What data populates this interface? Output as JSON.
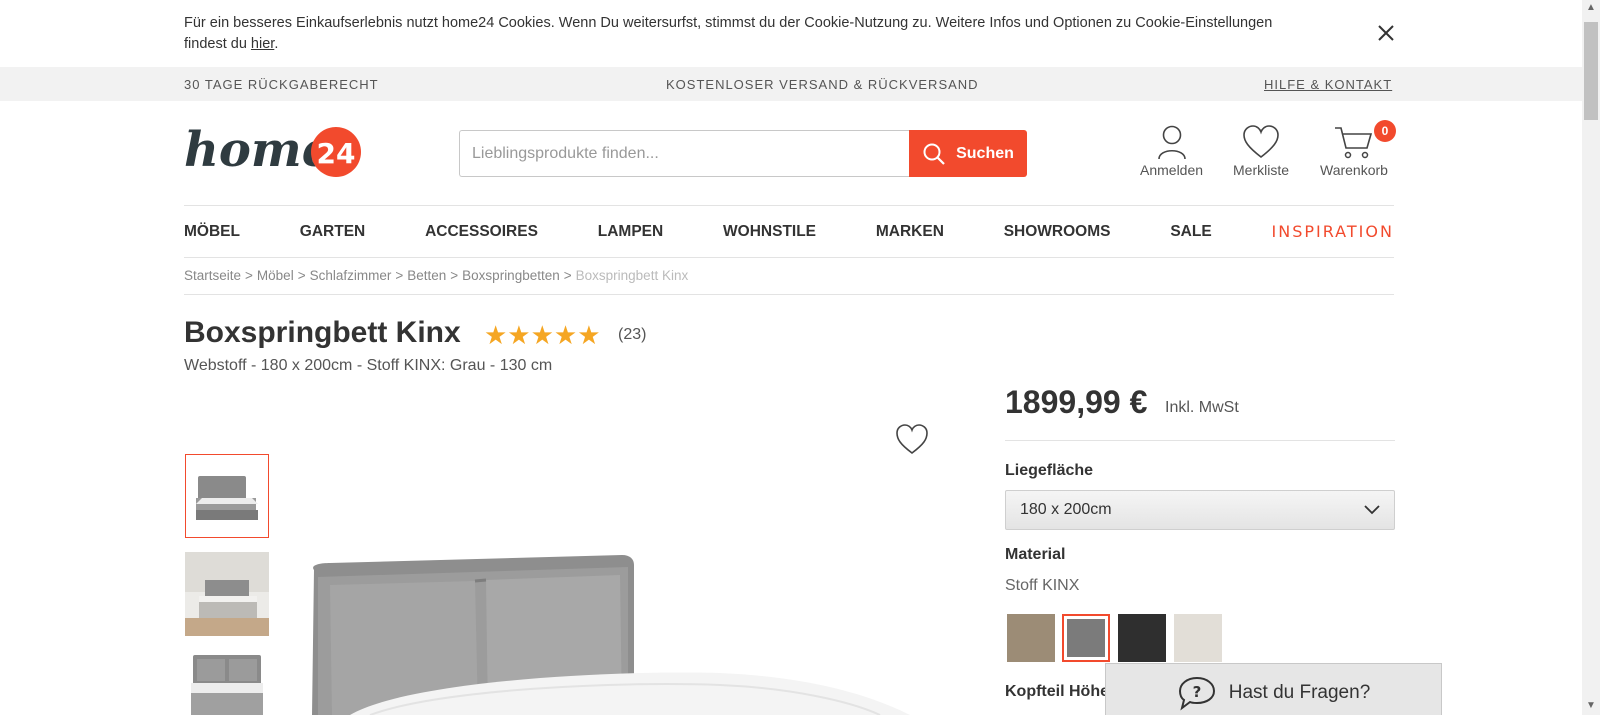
{
  "cookie": {
    "text": "Für ein besseres Einkaufserlebnis nutzt home24 Cookies. Wenn Du weitersurfst, stimmst du der Cookie-Nutzung zu. Weitere Infos und Optionen zu Cookie-Einstellungen findest du ",
    "link": "hier",
    "suffix": "."
  },
  "service": {
    "left": "30 TAGE RÜCKGABERECHT",
    "center": "KOSTENLOSER VERSAND & RÜCKVERSAND",
    "right": "HILFE & KONTAKT"
  },
  "header": {
    "logo_text": "home",
    "logo_number": "24",
    "search_placeholder": "Lieblingsprodukte finden...",
    "search_button": "Suchen",
    "login": "Anmelden",
    "wishlist": "Merkliste",
    "cart": "Warenkorb",
    "cart_count": "0"
  },
  "nav": [
    "MÖBEL",
    "GARTEN",
    "ACCESSOIRES",
    "LAMPEN",
    "WOHNSTILE",
    "MARKEN",
    "SHOWROOMS",
    "SALE",
    "INSPIRATION"
  ],
  "breadcrumb": [
    "Startseite",
    "Möbel",
    "Schlafzimmer",
    "Betten",
    "Boxspringbetten"
  ],
  "breadcrumb_current": "Boxspringbett Kinx",
  "breadcrumb_sep": ">",
  "product": {
    "title": "Boxspringbett Kinx",
    "stars": "★★★★★",
    "reviews": "(23)",
    "subtitle": "Webstoff - 180 x 200cm - Stoff KINX: Grau - 130 cm",
    "price": "1899,99 €",
    "vat": "Inkl. MwSt",
    "size_label": "Liegefläche",
    "size_value": "180 x 200cm",
    "material_label": "Material",
    "material_value": "Stoff KINX",
    "headboard_label": "Kopfteil Höhe"
  },
  "swatches": [
    {
      "color": "#9c8c76",
      "selected": false
    },
    {
      "color": "#7b7b7b",
      "selected": true
    },
    {
      "color": "#2f2f2f",
      "selected": false
    },
    {
      "color": "#e2ded7",
      "selected": false
    }
  ],
  "help": "Hast du Fragen?",
  "colors": {
    "accent": "#f24a2d",
    "star": "#f5a623"
  }
}
